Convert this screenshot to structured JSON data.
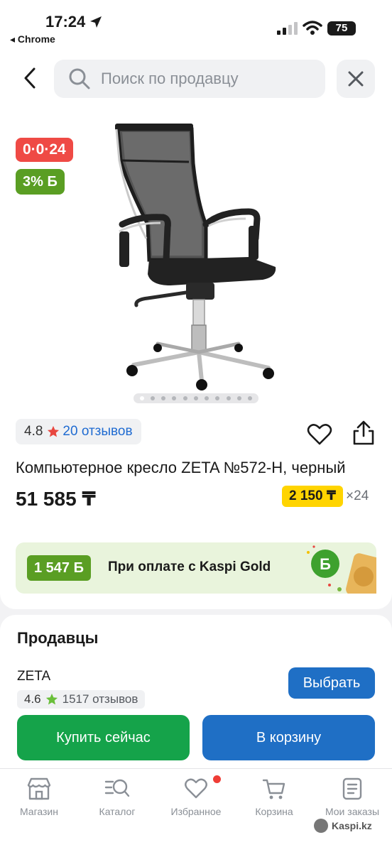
{
  "status_bar": {
    "time": "17:24",
    "back_app": "◂ Chrome",
    "battery": "75"
  },
  "search": {
    "placeholder": "Поиск по продавцу",
    "back_icon": "chevron-left-icon",
    "close_icon": "close-icon",
    "search_icon": "search-icon"
  },
  "product": {
    "timer_badge": "0·0·24",
    "bonus_badge": "3% Б",
    "image_count": 11,
    "active_image": 1,
    "rating": "4.8",
    "reviews_link": "20 отзывов",
    "title": "Компьютерное кресло ZETA №572-H, черный",
    "price": "51 585 ₸",
    "installment_amount": "2 150 ₸",
    "installment_multiplier": "×24"
  },
  "kaspi_gold": {
    "bonus": "1 547 Б",
    "text": "При оплате с Kaspi Gold"
  },
  "sellers": {
    "title": "Продавцы",
    "seller_name": "ZETA",
    "seller_rating": "4.6",
    "seller_reviews": "1517 отзывов",
    "select_label": "Выбрать"
  },
  "actions": {
    "buy_now": "Купить сейчас",
    "add_to_cart": "В корзину"
  },
  "tabs": [
    {
      "label": "Магазин",
      "icon": "store-icon"
    },
    {
      "label": "Каталог",
      "icon": "catalog-search-icon"
    },
    {
      "label": "Избранное",
      "icon": "heart-icon",
      "has_notification": true
    },
    {
      "label": "Корзина",
      "icon": "cart-icon"
    },
    {
      "label": "Мои заказы",
      "icon": "orders-icon"
    }
  ],
  "watermark": "Kaspi.kz",
  "colors": {
    "timer_red": "#ef4a45",
    "bonus_green": "#5a9e23",
    "installment_yellow": "#ffd400",
    "primary_blue": "#1f6fc5",
    "buy_green": "#15a34a",
    "link_blue": "#1f6bd1",
    "notification_red": "#ef3d36"
  }
}
